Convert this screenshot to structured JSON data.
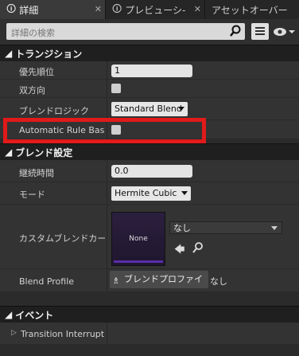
{
  "tabs": [
    {
      "label": "詳細",
      "active": true
    },
    {
      "label": "プレビューシ-",
      "active": false
    },
    {
      "label": "アセットオーバー",
      "active": false
    }
  ],
  "search": {
    "placeholder": "詳細の検索"
  },
  "sections": {
    "transition": {
      "title": "トランジション",
      "rows": [
        {
          "label": "優先順位",
          "value": "1"
        },
        {
          "label": "双方向"
        },
        {
          "label": "ブレンドロジック",
          "value": "Standard Blend"
        },
        {
          "label": "Automatic Rule Based"
        }
      ]
    },
    "blend": {
      "title": "ブレンド設定",
      "rows": [
        {
          "label": "継続時間",
          "value": "0.0"
        },
        {
          "label": "モード",
          "value": "Hermite Cubic"
        },
        {
          "label": "カスタムブレンドカーブ",
          "thumb": "None",
          "asset": "なし"
        },
        {
          "label": "Blend Profile",
          "button": "ブレンドプロファイル",
          "value": "なし"
        }
      ]
    },
    "events": {
      "title": "イベント",
      "rows": [
        {
          "label": "Transition Interrupt"
        }
      ]
    }
  }
}
